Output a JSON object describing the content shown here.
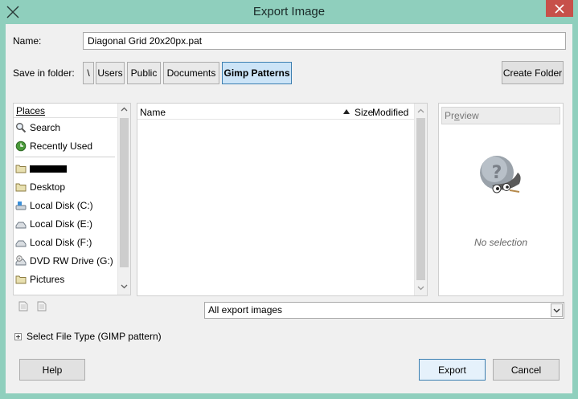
{
  "window": {
    "title": "Export Image"
  },
  "name_field": {
    "label": "Name:",
    "value": "Diagonal Grid 20x20px.pat"
  },
  "save_in": {
    "label": "Save in folder:",
    "crumbs": [
      "\\",
      "Users",
      "Public",
      "Documents",
      "Gimp Patterns"
    ]
  },
  "create_folder_label": "Create Folder",
  "places": {
    "header": "Places",
    "items": [
      {
        "label": "Search",
        "icon": "search-icon"
      },
      {
        "label": "Recently Used",
        "icon": "recent-icon"
      },
      {
        "label": "",
        "icon": "folder-icon"
      },
      {
        "label": "Desktop",
        "icon": "folder-icon"
      },
      {
        "label": "Local Disk (C:)",
        "icon": "drive-icon"
      },
      {
        "label": "Local Disk (E:)",
        "icon": "drive-icon"
      },
      {
        "label": "Local Disk (F:)",
        "icon": "drive-icon"
      },
      {
        "label": "DVD RW Drive (G:)",
        "icon": "dvd-icon"
      },
      {
        "label": "Pictures",
        "icon": "folder-icon"
      }
    ]
  },
  "files": {
    "columns": {
      "name": "Name",
      "size": "Size",
      "modified": "Modified"
    }
  },
  "preview": {
    "header": "Preview",
    "empty_text": "No selection"
  },
  "filter": {
    "value": "All export images"
  },
  "file_type_toggle": "Select File Type (GIMP pattern)",
  "buttons": {
    "help": "Help",
    "export": "Export",
    "cancel": "Cancel"
  }
}
